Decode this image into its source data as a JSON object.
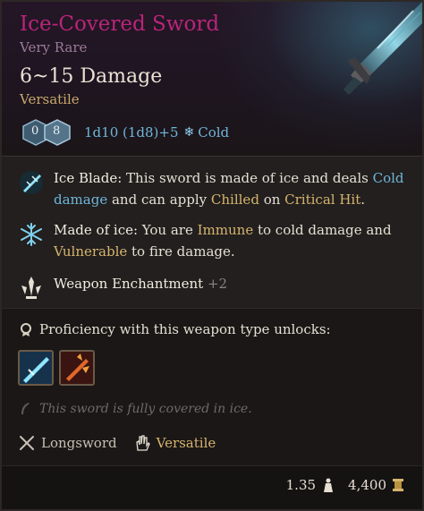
{
  "item": {
    "name": "Ice-Covered Sword",
    "rarity": "Very Rare",
    "damage": "6~15 Damage",
    "property": "Versatile",
    "dice": {
      "left_value": "0",
      "right_value": "8"
    },
    "formula": "1d10 (1d8)+5",
    "damage_type": "Cold",
    "damage_type_icon": "snowflake-icon"
  },
  "abilities": [
    {
      "icon": "ice-blade-icon",
      "name": "Ice Blade:",
      "text1": " This sword is made of ice and deals ",
      "kw1": "Cold damage",
      "text2": " and can apply ",
      "kw2": "Chilled",
      "text3": " on ",
      "kw3": "Critical Hit",
      "text4": "."
    },
    {
      "icon": "made-of-ice-icon",
      "name": "Made of ice:",
      "text1": " You are ",
      "kw1": "Immune",
      "text2": " to cold damage and ",
      "kw2": "Vulnerable",
      "text3": " to fire damage."
    },
    {
      "icon": "weapon-enchantment-icon",
      "name": "Weapon Enchantment",
      "bonus": "+2"
    }
  ],
  "proficiency": {
    "icon": "proficiency-icon",
    "text": "Proficiency with this weapon type unlocks:",
    "actions": [
      "ice-slash-action-icon",
      "fire-strike-action-icon"
    ]
  },
  "flavor": {
    "icon": "quill-icon",
    "text": "This sword is fully covered in ice."
  },
  "properties": [
    {
      "icon": "crossed-swords-icon",
      "label": "Longsword",
      "color": "#c8c0b4"
    },
    {
      "icon": "open-hand-icon",
      "label": "Versatile",
      "color": "#d6b46e"
    }
  ],
  "footer": {
    "weight": "1.35",
    "weight_icon": "weight-icon",
    "value": "4,400",
    "value_icon": "gold-coin-icon"
  },
  "colors": {
    "title": "#b8257a",
    "keyword_blue": "#6fb6d9",
    "keyword_gold": "#d6b46e"
  }
}
